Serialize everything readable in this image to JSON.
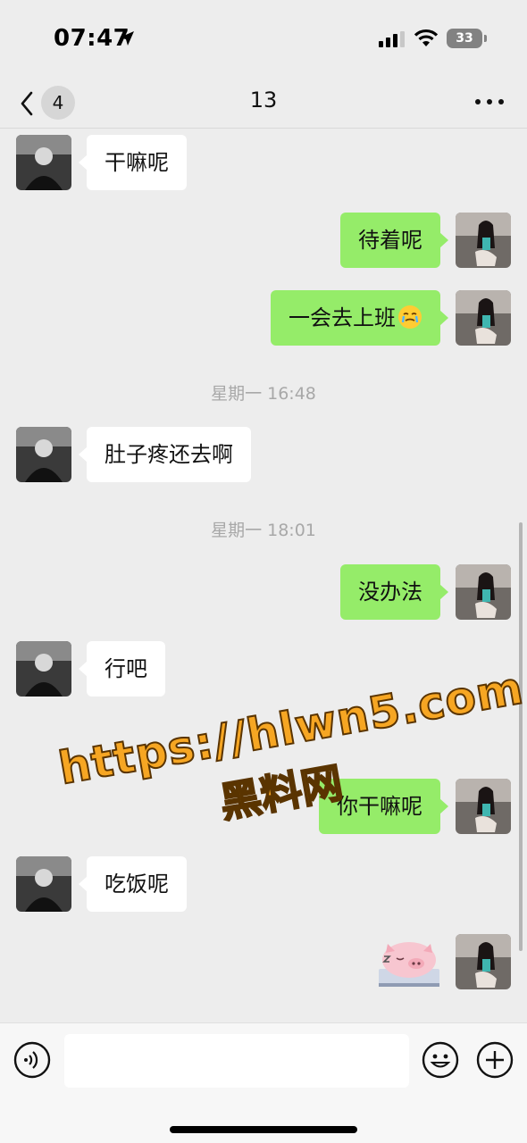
{
  "status_bar": {
    "time": "07:47",
    "battery": "33",
    "icons": [
      "location-arrow-icon",
      "signal-icon",
      "wifi-icon",
      "battery-icon"
    ]
  },
  "nav": {
    "unread_count": "4",
    "title": "13",
    "icons": [
      "chevron-left-icon",
      "more-icon"
    ]
  },
  "messages": [
    {
      "side": "in",
      "text": "干嘛呢"
    },
    {
      "side": "out",
      "text": "待着呢"
    },
    {
      "side": "out",
      "text": "一会去上班",
      "emoji": "crying-face-emoji"
    },
    {
      "type": "time",
      "text": "星期一 16:48"
    },
    {
      "side": "in",
      "text": "肚子疼还去啊"
    },
    {
      "type": "time",
      "text": "星期一 18:01"
    },
    {
      "side": "out",
      "text": "没办法"
    },
    {
      "side": "in",
      "text": "行吧"
    },
    {
      "side": "out",
      "text": "你干嘛呢"
    },
    {
      "side": "in",
      "text": "吃饭呢"
    },
    {
      "side": "out",
      "type": "sticker",
      "sticker": "sleeping-pig-sticker"
    }
  ],
  "watermark": {
    "url": "https://hlwn5.com",
    "name": "黑料网"
  },
  "input_bar": {
    "placeholder": "",
    "icons": [
      "voice-icon",
      "emoji-icon",
      "plus-icon"
    ]
  },
  "colors": {
    "background": "#ededed",
    "incoming_bubble": "#ffffff",
    "outgoing_bubble": "#95ec69",
    "timestamp": "#a8a8a8",
    "watermark": "#f6a623"
  }
}
